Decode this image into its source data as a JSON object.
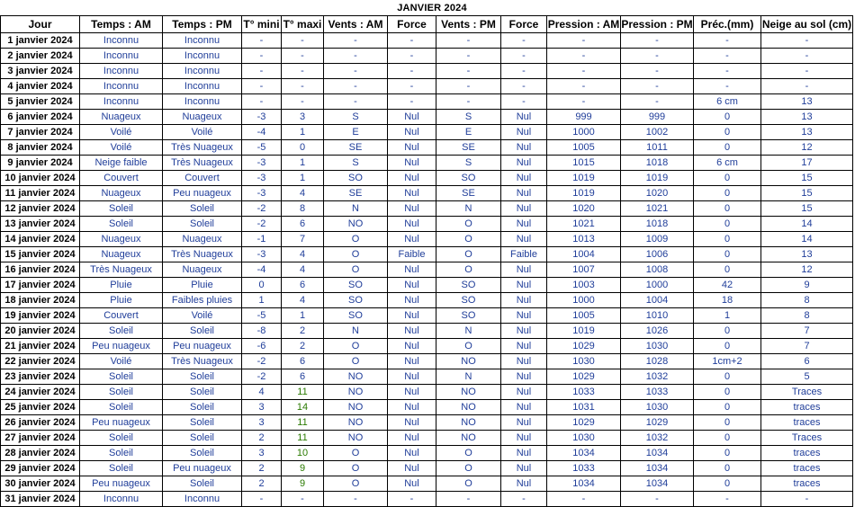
{
  "title": "JANVIER  2024",
  "headers": [
    "Jour",
    "Temps : AM",
    "Temps : PM",
    "T° mini",
    "T° maxi",
    "Vents : AM",
    "Force",
    "Vents : PM",
    "Force",
    "Pression : AM",
    "Pression : PM",
    "Préc.(mm)",
    "Neige au sol (cm)"
  ],
  "rows": [
    [
      "1 janvier 2024",
      "Inconnu",
      "Inconnu",
      "-",
      "-",
      "-",
      "-",
      "-",
      "-",
      "-",
      "-",
      "-",
      "-"
    ],
    [
      "2 janvier 2024",
      "Inconnu",
      "Inconnu",
      "-",
      "-",
      "-",
      "-",
      "-",
      "-",
      "-",
      "-",
      "-",
      "-"
    ],
    [
      "3 janvier 2024",
      "Inconnu",
      "Inconnu",
      "-",
      "-",
      "-",
      "-",
      "-",
      "-",
      "-",
      "-",
      "-",
      "-"
    ],
    [
      "4 janvier 2024",
      "Inconnu",
      "Inconnu",
      "-",
      "-",
      "-",
      "-",
      "-",
      "-",
      "-",
      "-",
      "-",
      "-"
    ],
    [
      "5 janvier 2024",
      "Inconnu",
      "Inconnu",
      "-",
      "-",
      "-",
      "-",
      "-",
      "-",
      "-",
      "-",
      "6 cm",
      "13"
    ],
    [
      "6 janvier 2024",
      "Nuageux",
      "Nuageux",
      "-3",
      "3",
      "S",
      "Nul",
      "S",
      "Nul",
      "999",
      "999",
      "0",
      "13"
    ],
    [
      "7 janvier 2024",
      "Voilé",
      "Voilé",
      "-4",
      "1",
      "E",
      "Nul",
      "E",
      "Nul",
      "1000",
      "1002",
      "0",
      "13"
    ],
    [
      "8 janvier 2024",
      "Voilé",
      "Très Nuageux",
      "-5",
      "0",
      "SE",
      "Nul",
      "SE",
      "Nul",
      "1005",
      "1011",
      "0",
      "12"
    ],
    [
      "9 janvier 2024",
      "Neige faible",
      "Très Nuageux",
      "-3",
      "1",
      "S",
      "Nul",
      "S",
      "Nul",
      "1015",
      "1018",
      "6 cm",
      "17"
    ],
    [
      "10 janvier 2024",
      "Couvert",
      "Couvert",
      "-3",
      "1",
      "SO",
      "Nul",
      "SO",
      "Nul",
      "1019",
      "1019",
      "0",
      "15"
    ],
    [
      "11 janvier 2024",
      "Nuageux",
      "Peu nuageux",
      "-3",
      "4",
      "SE",
      "Nul",
      "SE",
      "Nul",
      "1019",
      "1020",
      "0",
      "15"
    ],
    [
      "12 janvier 2024",
      "Soleil",
      "Soleil",
      "-2",
      "8",
      "N",
      "Nul",
      "N",
      "Nul",
      "1020",
      "1021",
      "0",
      "15"
    ],
    [
      "13 janvier 2024",
      "Soleil",
      "Soleil",
      "-2",
      "6",
      "NO",
      "Nul",
      "O",
      "Nul",
      "1021",
      "1018",
      "0",
      "14"
    ],
    [
      "14 janvier 2024",
      "Nuageux",
      "Nuageux",
      "-1",
      "7",
      "O",
      "Nul",
      "O",
      "Nul",
      "1013",
      "1009",
      "0",
      "14"
    ],
    [
      "15 janvier 2024",
      "Nuageux",
      "Très Nuageux",
      "-3",
      "4",
      "O",
      "Faible",
      "O",
      "Faible",
      "1004",
      "1006",
      "0",
      "13"
    ],
    [
      "16 janvier 2024",
      "Très Nuageux",
      "Nuageux",
      "-4",
      "4",
      "O",
      "Nul",
      "O",
      "Nul",
      "1007",
      "1008",
      "0",
      "12"
    ],
    [
      "17 janvier 2024",
      "Pluie",
      "Pluie",
      "0",
      "6",
      "SO",
      "Nul",
      "SO",
      "Nul",
      "1003",
      "1000",
      "42",
      "9"
    ],
    [
      "18 janvier 2024",
      "Pluie",
      "Faibles pluies",
      "1",
      "4",
      "SO",
      "Nul",
      "SO",
      "Nul",
      "1000",
      "1004",
      "18",
      "8"
    ],
    [
      "19 janvier 2024",
      "Couvert",
      "Voilé",
      "-5",
      "1",
      "SO",
      "Nul",
      "SO",
      "Nul",
      "1005",
      "1010",
      "1",
      "8"
    ],
    [
      "20 janvier 2024",
      "Soleil",
      "Soleil",
      "-8",
      "2",
      "N",
      "Nul",
      "N",
      "Nul",
      "1019",
      "1026",
      "0",
      "7"
    ],
    [
      "21 janvier 2024",
      "Peu nuageux",
      "Peu nuageux",
      "-6",
      "2",
      "O",
      "Nul",
      "O",
      "Nul",
      "1029",
      "1030",
      "0",
      "7"
    ],
    [
      "22 janvier 2024",
      "Voilé",
      "Très Nuageux",
      "-2",
      "6",
      "O",
      "Nul",
      "NO",
      "Nul",
      "1030",
      "1028",
      "1cm+2",
      "6"
    ],
    [
      "23 janvier 2024",
      "Soleil",
      "Soleil",
      "-2",
      "6",
      "NO",
      "Nul",
      "N",
      "Nul",
      "1029",
      "1032",
      "0",
      "5"
    ],
    [
      "24 janvier 2024",
      "Soleil",
      "Soleil",
      "4",
      "11",
      "NO",
      "Nul",
      "NO",
      "Nul",
      "1033",
      "1033",
      "0",
      "Traces"
    ],
    [
      "25 janvier 2024",
      "Soleil",
      "Soleil",
      "3",
      "14",
      "NO",
      "Nul",
      "NO",
      "Nul",
      "1031",
      "1030",
      "0",
      "traces"
    ],
    [
      "26 janvier 2024",
      "Peu nuageux",
      "Soleil",
      "3",
      "11",
      "NO",
      "Nul",
      "NO",
      "Nul",
      "1029",
      "1029",
      "0",
      "traces"
    ],
    [
      "27 janvier 2024",
      "Soleil",
      "Soleil",
      "2",
      "11",
      "NO",
      "Nul",
      "NO",
      "Nul",
      "1030",
      "1032",
      "0",
      "Traces"
    ],
    [
      "28 janvier 2024",
      "Soleil",
      "Soleil",
      "3",
      "10",
      "O",
      "Nul",
      "O",
      "Nul",
      "1034",
      "1034",
      "0",
      "traces"
    ],
    [
      "29 janvier 2024",
      "Soleil",
      "Peu nuageux",
      "2",
      "9",
      "O",
      "Nul",
      "O",
      "Nul",
      "1033",
      "1034",
      "0",
      "traces"
    ],
    [
      "30 janvier 2024",
      "Peu nuageux",
      "Soleil",
      "2",
      "9",
      "O",
      "Nul",
      "O",
      "Nul",
      "1034",
      "1034",
      "0",
      "traces"
    ],
    [
      "31 janvier 2024",
      "Inconnu",
      "Inconnu",
      "-",
      "-",
      "-",
      "-",
      "-",
      "-",
      "-",
      "-",
      "-",
      "-"
    ]
  ],
  "colors": {
    "text_blue": "#1f3d99",
    "text_green": "#2a7a00",
    "text_black": "#000000",
    "border": "#000000",
    "background": "#ffffff"
  }
}
